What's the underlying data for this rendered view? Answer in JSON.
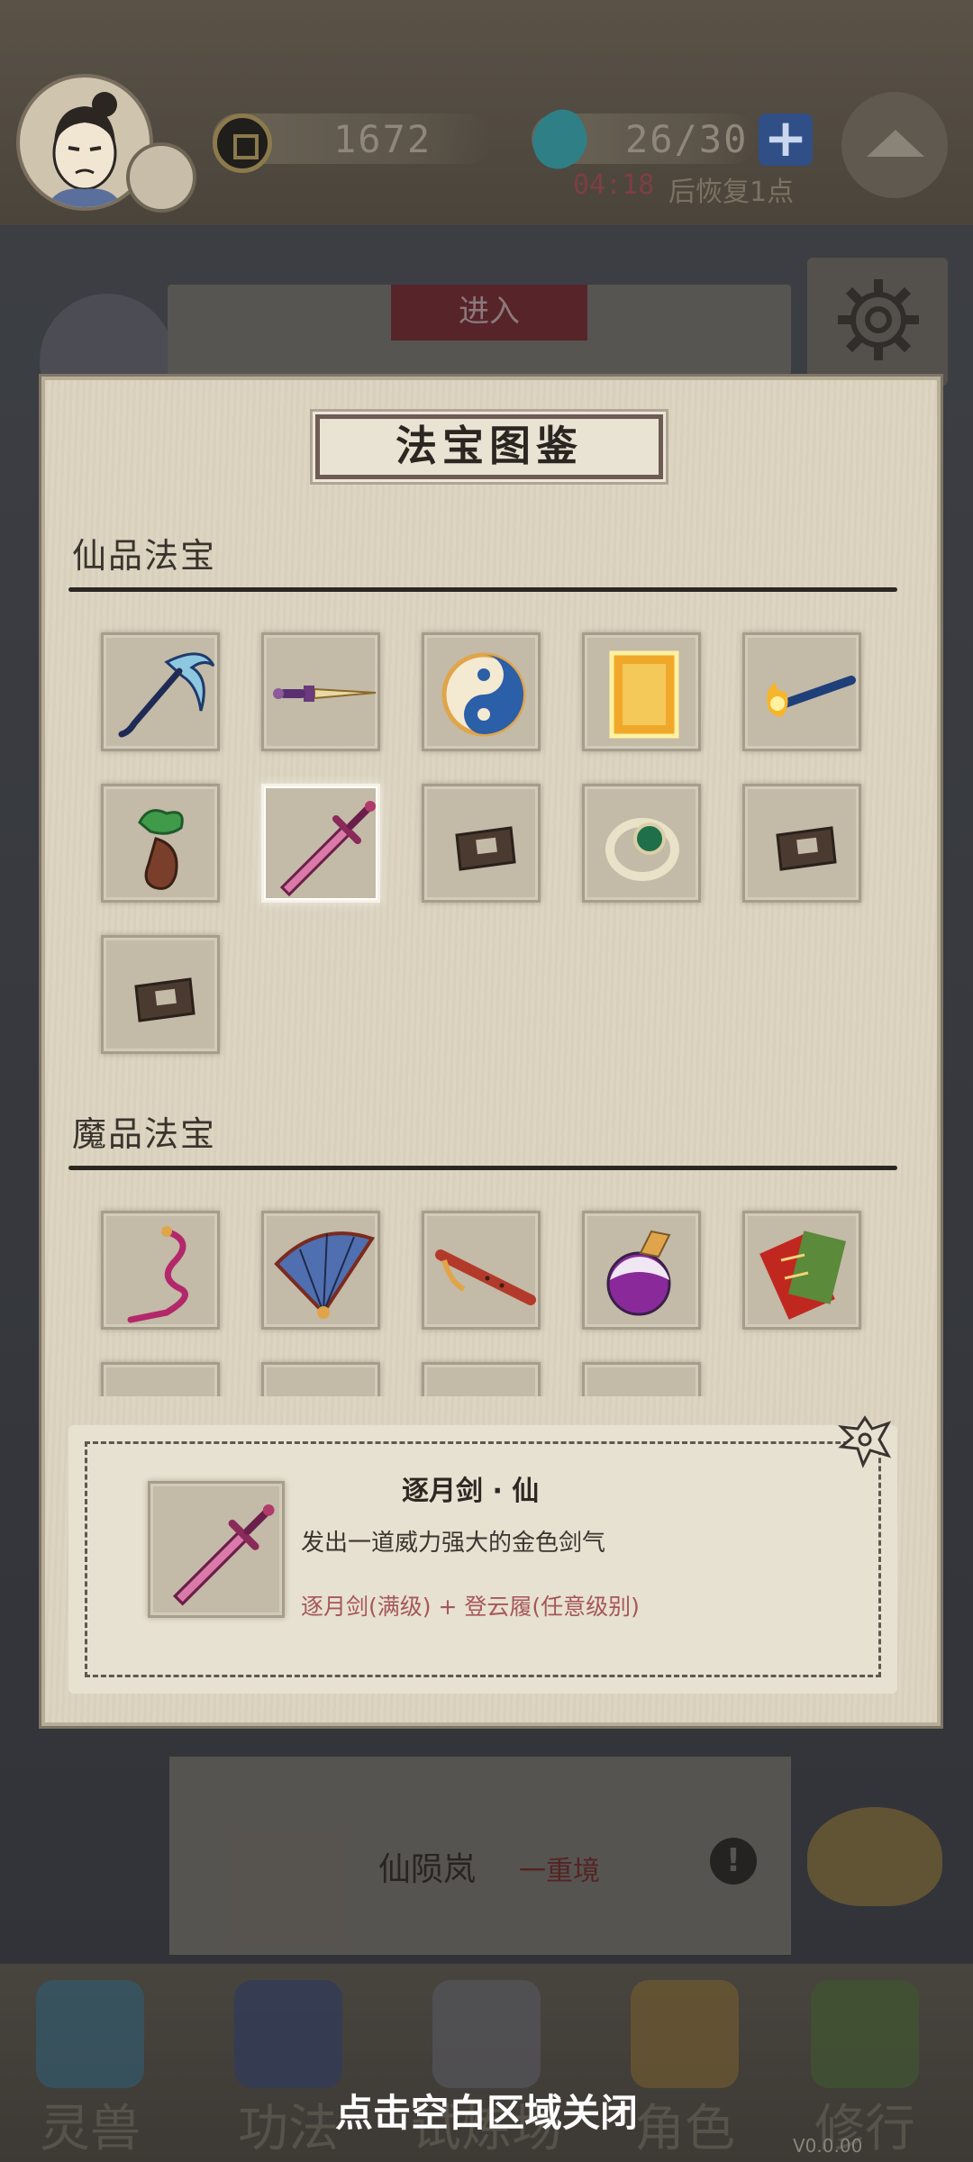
{
  "header": {
    "coins": "1672",
    "stamina": "26/30",
    "plus_label": "+",
    "regen_timer": "04:18",
    "regen_text": "后恢复1点"
  },
  "background": {
    "enter_label": "进入",
    "card_title": "仙陨岚",
    "card_level": "一重境",
    "info_label": "!"
  },
  "modal": {
    "title": "法宝图鉴",
    "sections": [
      {
        "title": "仙品法宝",
        "items": [
          {
            "icon": "crescent-staff-icon",
            "locked": false
          },
          {
            "icon": "dagger-icon",
            "locked": false
          },
          {
            "icon": "yin-yang-icon",
            "locked": false
          },
          {
            "icon": "golden-mirror-icon",
            "locked": false
          },
          {
            "icon": "fire-brush-icon",
            "locked": false
          },
          {
            "icon": "jade-gourd-icon",
            "locked": false
          },
          {
            "icon": "moon-sword-icon",
            "locked": false,
            "selected": true
          },
          {
            "icon": "locked-icon",
            "locked": true
          },
          {
            "icon": "jade-ring-icon",
            "locked": false
          },
          {
            "icon": "locked-icon",
            "locked": true
          },
          {
            "icon": "locked-icon",
            "locked": true
          }
        ]
      },
      {
        "title": "魔品法宝",
        "items": [
          {
            "icon": "ribbon-whip-icon",
            "locked": false
          },
          {
            "icon": "folding-fan-icon",
            "locked": false
          },
          {
            "icon": "flute-icon",
            "locked": false
          },
          {
            "icon": "potion-flask-icon",
            "locked": false
          },
          {
            "icon": "talisman-cards-icon",
            "locked": false
          }
        ]
      }
    ],
    "detail": {
      "name": "逐月剑 · 仙",
      "description": "发出一道威力强大的金色剑气",
      "recipe": "逐月剑(满级) + 登云履(任意级别)",
      "icon": "moon-sword-icon"
    }
  },
  "bottom_nav": {
    "items": [
      {
        "label": "灵兽",
        "icon": "spirit-beast-icon"
      },
      {
        "label": "功法",
        "icon": "manual-book-icon"
      },
      {
        "label": "试炼场",
        "icon": "trial-mountain-icon"
      },
      {
        "label": "角色",
        "icon": "character-icon"
      },
      {
        "label": "修行",
        "icon": "cultivation-gourd-icon"
      }
    ],
    "close_hint": "点击空白区域关闭",
    "version": "V0.0.00"
  },
  "colors": {
    "parchment": "#dcd4c0",
    "accent_red": "#a6575a",
    "ink": "#2b2622",
    "stamina_plus": "#2f4f86"
  }
}
